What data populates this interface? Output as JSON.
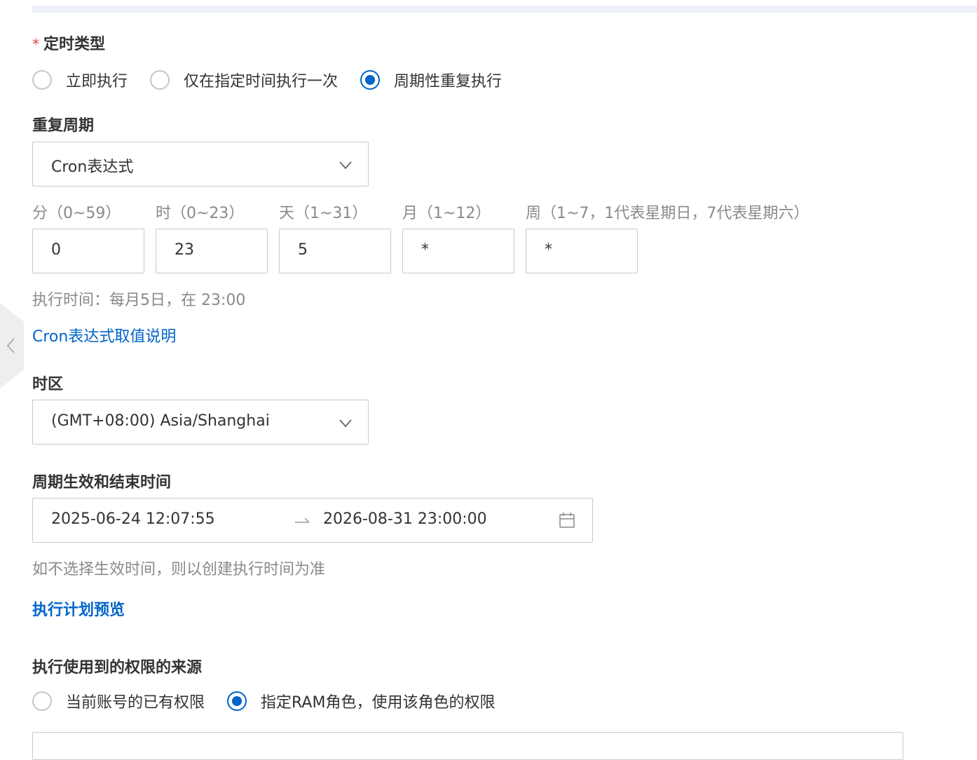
{
  "schedule_type": {
    "label": "定时类型",
    "required_mark": "*",
    "options": [
      "立即执行",
      "仅在指定时间执行一次",
      "周期性重复执行"
    ],
    "selected_index": 2
  },
  "repeat_cycle": {
    "label": "重复周期",
    "value": "Cron表达式"
  },
  "cron": {
    "fields": [
      {
        "header": "分（0~59）",
        "value": "0"
      },
      {
        "header": "时（0~23）",
        "value": "23"
      },
      {
        "header": "天（1~31）",
        "value": "5"
      },
      {
        "header": "月（1~12）",
        "value": "*"
      },
      {
        "header": "周（1~7，1代表星期日，7代表星期六）",
        "value": "*"
      }
    ],
    "execution_time_text": "执行时间：每月5日，在 23:00",
    "help_link": "Cron表达式取值说明"
  },
  "timezone": {
    "label": "时区",
    "value": "(GMT+08:00) Asia/Shanghai"
  },
  "period": {
    "label": "周期生效和结束时间",
    "start": "2025-06-24 12:07:55",
    "end": "2026-08-31 23:00:00",
    "hint": "如不选择生效时间，则以创建执行时间为准",
    "preview_link": "执行计划预览"
  },
  "permission_source": {
    "label": "执行使用到的权限的来源",
    "options": [
      "当前账号的已有权限",
      "指定RAM角色，使用该角色的权限"
    ],
    "selected_index": 1
  },
  "colors": {
    "accent": "#0064c8",
    "required": "#e54545",
    "border": "#c9c9c9",
    "muted_text": "#8a8a8a"
  }
}
